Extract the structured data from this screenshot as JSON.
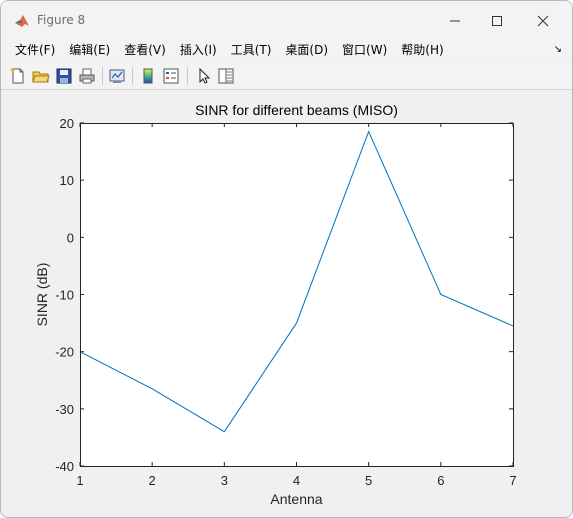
{
  "window": {
    "title": "Figure 8"
  },
  "menu": {
    "items": [
      "文件(F)",
      "编辑(E)",
      "查看(V)",
      "插入(I)",
      "工具(T)",
      "桌面(D)",
      "窗口(W)",
      "帮助(H)"
    ],
    "overflow_icon": "dock-arrow-icon"
  },
  "toolbar": {
    "icons": [
      "new-figure-icon",
      "open-file-icon",
      "save-icon",
      "print-icon",
      "link-plot-icon",
      "insert-colorbar-icon",
      "insert-legend-icon",
      "edit-plot-arrow-icon",
      "property-inspector-icon"
    ]
  },
  "colors": {
    "line": "#0072bd",
    "axes_bg": "#ffffff",
    "figure_bg": "#f0f0f0"
  },
  "chart_data": {
    "type": "line",
    "title": "SINR for different beams (MISO)",
    "xlabel": "Antenna",
    "ylabel": "SINR (dB)",
    "x": [
      1,
      2,
      3,
      4,
      5,
      6,
      7
    ],
    "y": [
      -20,
      -26.5,
      -34,
      -15,
      18.5,
      -10,
      -15.5
    ],
    "xlim": [
      1,
      7
    ],
    "ylim": [
      -40,
      20
    ],
    "xticks": [
      "1",
      "2",
      "3",
      "4",
      "5",
      "6",
      "7"
    ],
    "yticks": [
      "20",
      "10",
      "0",
      "-10",
      "-20",
      "-30",
      "-40"
    ],
    "grid": false
  }
}
